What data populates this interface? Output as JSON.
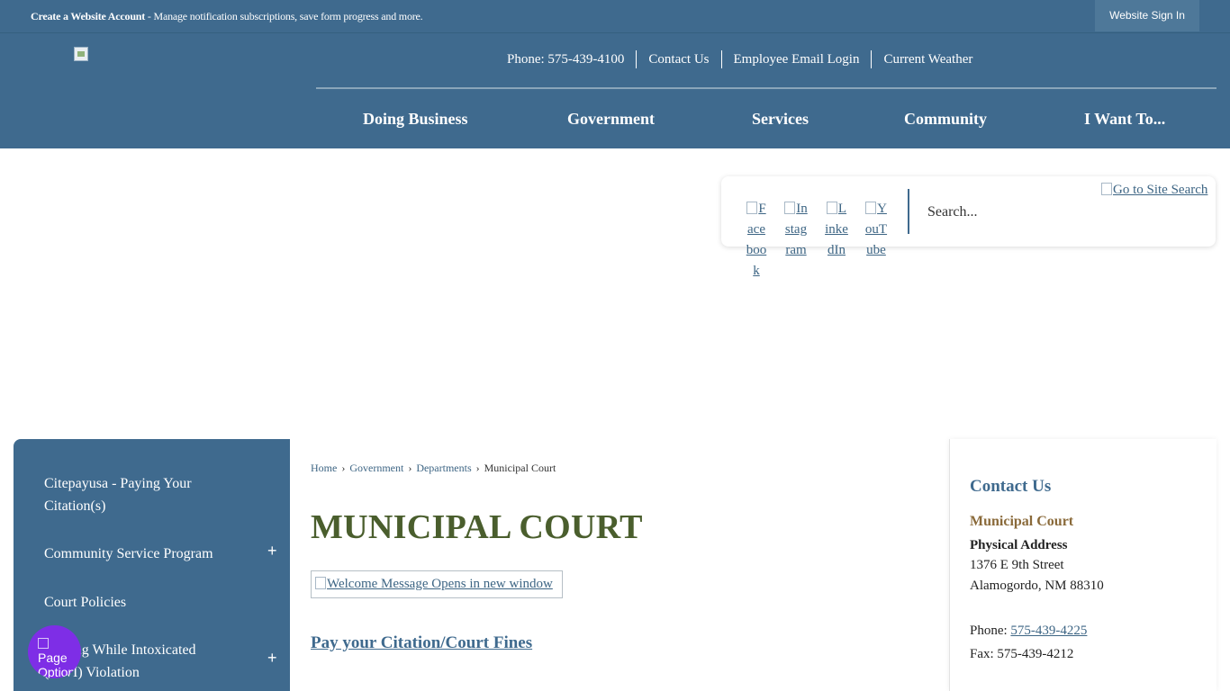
{
  "topbar": {
    "create_account_bold": "Create a Website Account",
    "create_account_text": " - Manage notification subscriptions, save form progress and more.",
    "sign_in": "Website Sign In"
  },
  "utility_links": [
    "Phone: 575-439-4100",
    "Contact Us",
    "Employee Email Login",
    "Current Weather"
  ],
  "main_nav": [
    "Doing Business",
    "Government",
    "Services",
    "Community",
    "I Want To..."
  ],
  "social": {
    "facebook": "Facebook",
    "instagram": "Instagram",
    "linkedin": "LinkedIn",
    "youtube": "YouTube"
  },
  "search": {
    "placeholder": "Search...",
    "go_label": "Go to Site Search"
  },
  "sidenav": {
    "items": [
      "Citepayusa - Paying Your Citation(s)",
      "Community Service Program",
      "Court Policies",
      "Driving While Intoxicated (DWI) Violation"
    ],
    "expand_symbol": "+"
  },
  "page_options": {
    "label": "Page Options"
  },
  "breadcrumb": {
    "home": "Home",
    "government": "Government",
    "departments": "Departments",
    "current": "Municipal Court",
    "separator": "›"
  },
  "main": {
    "title": "MUNICIPAL COURT",
    "welcome_image_alt": "Welcome Message Opens in new window",
    "pay_link": "Pay your Citation/Court Fines"
  },
  "contact": {
    "heading": "Contact Us",
    "department": "Municipal Court",
    "address_label": "Physical Address",
    "address_line1": "1376 E 9th Street",
    "address_line2": "Alamogordo, NM 88310",
    "phone_label": "Phone: ",
    "phone_number": "575-439-4225",
    "fax": "Fax: 575-439-4212"
  },
  "colors": {
    "header_blue": "#3f6a8e",
    "title_green": "#4a5e2d",
    "department_brown": "#8a6a3a",
    "page_options_purple": "#7e2ee6"
  }
}
